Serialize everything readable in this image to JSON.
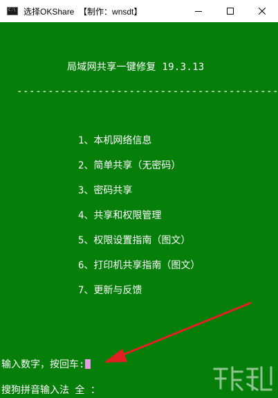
{
  "window": {
    "title": "选择OKShare  【制作：wnsdt】",
    "minimize_label": "–",
    "colors": {
      "console_bg": "#067f0a",
      "console_fg": "#ffffff",
      "cursor": "#e59ae6",
      "arrow": "#e02020"
    },
    "icons": [
      "console-app-icon",
      "minimize-icon",
      "maximize-icon",
      "close-icon"
    ]
  },
  "console": {
    "heading": "局域网共享一键修复 19.3.13",
    "divider": "--------------------------------------------",
    "menu": [
      "1、本机网络信息",
      "2、简单共享（无密码）",
      "3、密码共享",
      "4、共享和权限管理",
      "5、权限设置指南（图文）",
      "6、打印机共享指南（图文）",
      "7、更新与反馈"
    ],
    "prompt": "输入数字，按回车:",
    "ime_status": "搜狗拼音输入法 全 ："
  }
}
